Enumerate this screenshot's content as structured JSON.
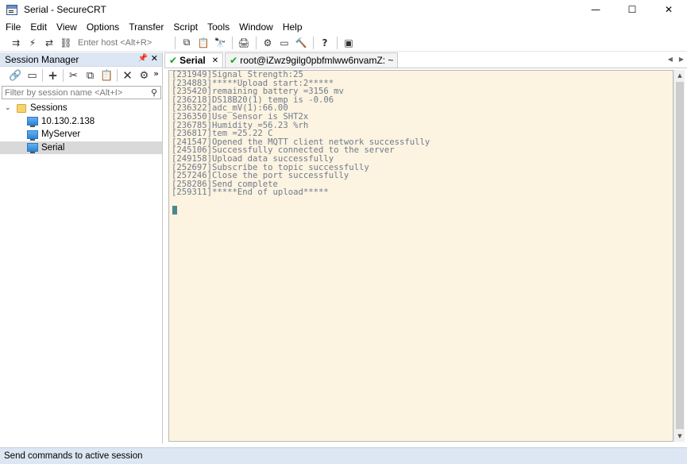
{
  "window": {
    "title": "Serial - SecureCRT",
    "minimize": "—",
    "maximize": "☐",
    "close": "✕"
  },
  "menu": [
    "File",
    "Edit",
    "View",
    "Options",
    "Transfer",
    "Script",
    "Tools",
    "Window",
    "Help"
  ],
  "toolbar": {
    "host_placeholder": "Enter host <Alt+R>"
  },
  "session_manager": {
    "title": "Session Manager",
    "pin": "📌",
    "close": "✕",
    "more": "»",
    "filter_placeholder": "Filter by session name <Alt+I>",
    "tree": {
      "root": "Sessions",
      "items": [
        "10.130.2.138",
        "MyServer",
        "Serial"
      ]
    }
  },
  "tabs": [
    {
      "label": "Serial",
      "close": "✕",
      "active": true
    },
    {
      "label": "root@iZwz9gilg0pbfmlww6nvamZ: ~",
      "active": false
    }
  ],
  "terminal": {
    "lines": [
      "[231949]Signal Strength:25",
      "[234883]*****Upload start:2*****",
      "[235420]remaining battery =3156 mv",
      "[236218]DS18B20(1) temp is -0.06",
      "[236322]adc_mV(1):66.00",
      "[236350]Use Sensor is SHT2x",
      "[236785]Humidity =56.23 %rh",
      "[236817]tem =25.22 C",
      "[241547]Opened the MQTT client network successfully",
      "[245106]Successfully connected to the server",
      "[249158]Upload data successfully",
      "[252697]Subscribe to topic successfully",
      "[257246]Close the port successfully",
      "[258286]Send complete",
      "[259311]*****End of upload*****"
    ]
  },
  "command_bar": {
    "label": "Send commands to active session"
  }
}
